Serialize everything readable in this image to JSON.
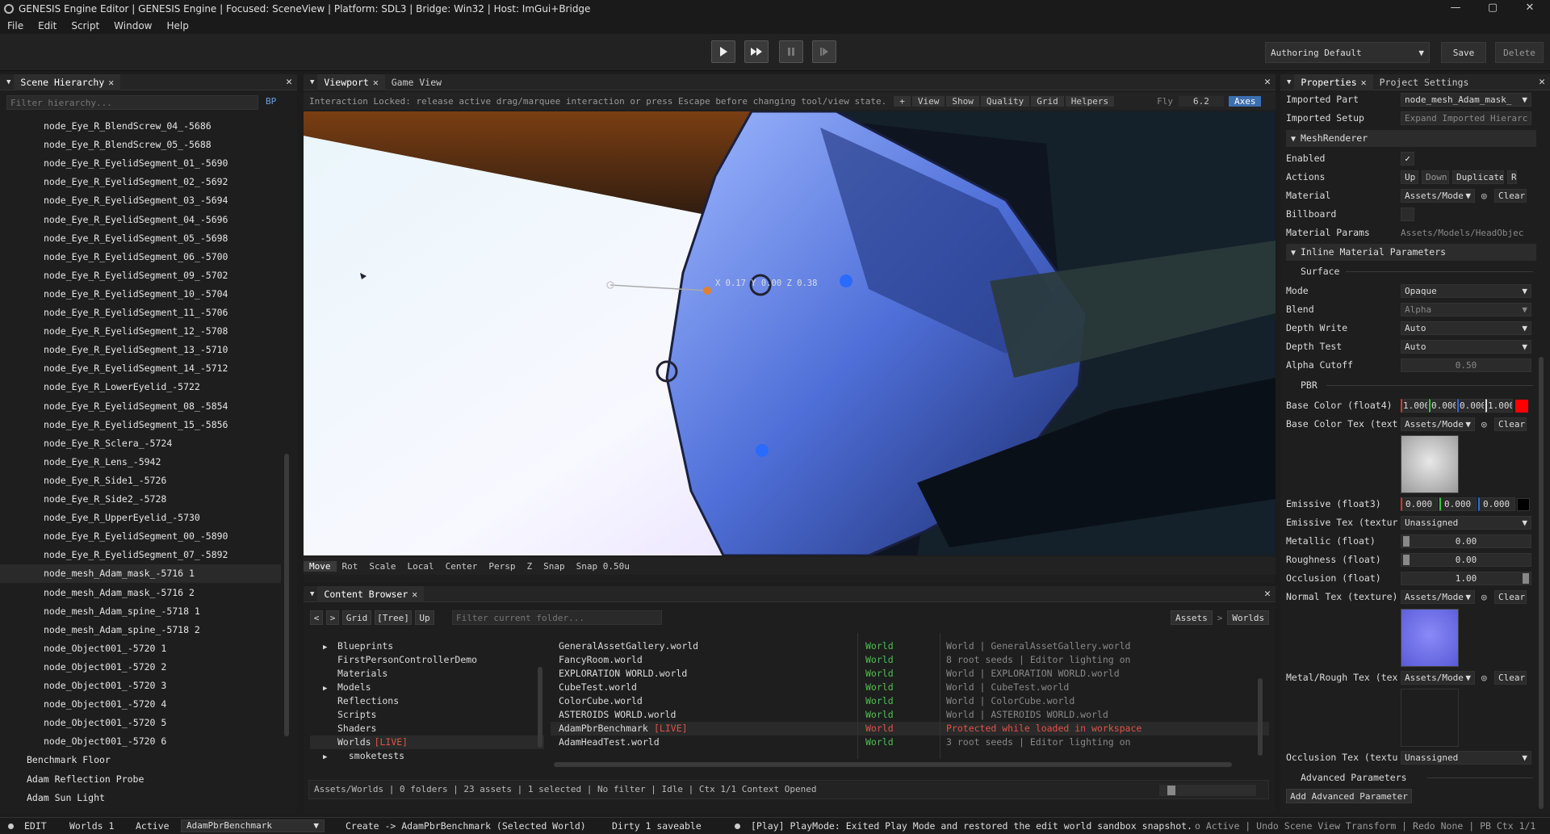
{
  "window": {
    "title": "GENESIS Engine Editor | GENESIS Engine | Focused: SceneView | Platform: SDL3 | Bridge: Win32 | Host: ImGui+Bridge",
    "min": "—",
    "max": "▢",
    "close": "✕"
  },
  "menu": [
    "File",
    "Edit",
    "Script",
    "Window",
    "Help"
  ],
  "toolbar": {
    "layout_combo": "Authoring Default",
    "save": "Save",
    "delete": "Delete"
  },
  "hierarchy": {
    "tab": "Scene Hierarchy",
    "filter_placeholder": "Filter hierarchy...",
    "bp": "BP",
    "items": [
      "node_Eye_R_BlendScrew_04_-5686",
      "node_Eye_R_BlendScrew_05_-5688",
      "node_Eye_R_EyelidSegment_01_-5690",
      "node_Eye_R_EyelidSegment_02_-5692",
      "node_Eye_R_EyelidSegment_03_-5694",
      "node_Eye_R_EyelidSegment_04_-5696",
      "node_Eye_R_EyelidSegment_05_-5698",
      "node_Eye_R_EyelidSegment_06_-5700",
      "node_Eye_R_EyelidSegment_09_-5702",
      "node_Eye_R_EyelidSegment_10_-5704",
      "node_Eye_R_EyelidSegment_11_-5706",
      "node_Eye_R_EyelidSegment_12_-5708",
      "node_Eye_R_EyelidSegment_13_-5710",
      "node_Eye_R_EyelidSegment_14_-5712",
      "node_Eye_R_LowerEyelid_-5722",
      "node_Eye_R_EyelidSegment_08_-5854",
      "node_Eye_R_EyelidSegment_15_-5856",
      "node_Eye_R_Sclera_-5724",
      "node_Eye_R_Lens_-5942",
      "node_Eye_R_Side1_-5726",
      "node_Eye_R_Side2_-5728",
      "node_Eye_R_UpperEyelid_-5730",
      "node_Eye_R_EyelidSegment_00_-5890",
      "node_Eye_R_EyelidSegment_07_-5892",
      "node_mesh_Adam_mask_-5716 1",
      "node_mesh_Adam_mask_-5716 2",
      "node_mesh_Adam_spine_-5718 1",
      "node_mesh_Adam_spine_-5718 2",
      "node_Object001_-5720 1",
      "node_Object001_-5720 2",
      "node_Object001_-5720 3",
      "node_Object001_-5720 4",
      "node_Object001_-5720 5",
      "node_Object001_-5720 6"
    ],
    "root_items": [
      "Benchmark Floor",
      "Adam Reflection Probe",
      "Adam Sun Light"
    ]
  },
  "viewport": {
    "tabs": [
      "Viewport",
      "Game View"
    ],
    "notice": "Interaction Locked: release active drag/marquee interaction or press Escape before changing tool/view state.",
    "top_buttons": [
      "+",
      "View",
      "Show",
      "Quality",
      "Grid",
      "Helpers"
    ],
    "fly_label": "Fly",
    "fly_value": "6.2",
    "axes": "Axes",
    "gizmo_readout": "X 0.17  Y 0.00  Z 0.38",
    "bottom_buttons": [
      "Move",
      "Rot",
      "Scale",
      "Local",
      "Center",
      "Persp",
      "Z",
      "Snap",
      "Snap 0.50u"
    ]
  },
  "content": {
    "tab": "Content Browser",
    "nav": [
      "<",
      ">",
      "Grid",
      "[Tree]",
      "Up"
    ],
    "filter_placeholder": "Filter current folder...",
    "crumbs": [
      "Assets",
      ">",
      "Worlds"
    ],
    "tree": [
      {
        "label": "Blueprints",
        "arrow": "▶"
      },
      {
        "label": "FirstPersonControllerDemo",
        "arrow": ""
      },
      {
        "label": "Materials",
        "arrow": ""
      },
      {
        "label": "Models",
        "arrow": "▶"
      },
      {
        "label": "Reflections",
        "arrow": ""
      },
      {
        "label": "Scripts",
        "arrow": ""
      },
      {
        "label": "Shaders",
        "arrow": ""
      },
      {
        "label": "Worlds",
        "arrow": "",
        "live": "[LIVE]"
      },
      {
        "label": "__smoketests",
        "arrow": "▶"
      }
    ],
    "rows": [
      {
        "name": "GeneralAssetGallery.world",
        "type": "World",
        "desc": "World | GeneralAssetGallery.world"
      },
      {
        "name": "FancyRoom.world",
        "type": "World",
        "desc": "8 root seeds | Editor lighting on"
      },
      {
        "name": "EXPLORATION WORLD.world",
        "type": "World",
        "desc": "World | EXPLORATION WORLD.world"
      },
      {
        "name": "CubeTest.world",
        "type": "World",
        "desc": "World | CubeTest.world"
      },
      {
        "name": "ColorCube.world",
        "type": "World",
        "desc": "World | ColorCube.world"
      },
      {
        "name": "ASTEROIDS WORLD.world",
        "type": "World",
        "desc": "World | ASTEROIDS WORLD.world"
      },
      {
        "name": "AdamPbrBenchmark",
        "live": "[LIVE]",
        "type": "World",
        "desc": "Protected while loaded in workspace"
      },
      {
        "name": "AdamHeadTest.world",
        "type": "World",
        "desc": "3 root seeds | Editor lighting on"
      }
    ],
    "status": "Assets/Worlds | 0 folders | 23 assets | 1 selected | No filter | Idle | Ctx 1/1 Context Opened"
  },
  "properties": {
    "tabs": [
      "Properties",
      "Project Settings"
    ],
    "imported_part_label": "Imported Part",
    "imported_part_value": "node_mesh_Adam_mask_",
    "imported_setup_label": "Imported Setup",
    "imported_setup_value": "Expand Imported Hierarc",
    "mesh_renderer": "MeshRenderer",
    "enabled_label": "Enabled",
    "actions_label": "Actions",
    "actions": [
      "Up",
      "Down",
      "Duplicate",
      "R"
    ],
    "material_label": "Material",
    "material_value": "Assets/Mode",
    "clear": "Clear",
    "billboard_label": "Billboard",
    "material_params_label": "Material Params",
    "material_params_value": "Assets/Models/HeadObjec",
    "inline_header": "Inline Material Parameters",
    "surface": "Surface",
    "mode_label": "Mode",
    "mode_value": "Opaque",
    "blend_label": "Blend",
    "blend_value": "Alpha",
    "depth_write_label": "Depth Write",
    "depth_write_value": "Auto",
    "depth_test_label": "Depth Test",
    "depth_test_value": "Auto",
    "alpha_cutoff_label": "Alpha Cutoff",
    "alpha_cutoff_value": "0.50",
    "pbr": "PBR",
    "base_color_label": "Base Color (float4)",
    "base_color": [
      "1.000",
      "0.000",
      "0.000",
      "1.000"
    ],
    "base_color_tex_label": "Base Color Tex (text",
    "base_color_tex_value": "Assets/Mode",
    "emissive_label": "Emissive (float3)",
    "emissive": [
      "0.000",
      "0.000",
      "0.000"
    ],
    "emissive_tex_label": "Emissive Tex (textur",
    "emissive_tex_value": "Unassigned",
    "metallic_label": "Metallic (float)",
    "metallic_value": "0.00",
    "roughness_label": "Roughness (float)",
    "roughness_value": "0.00",
    "occlusion_label": "Occlusion (float)",
    "occlusion_value": "1.00",
    "normal_tex_label": "Normal Tex (texture)",
    "normal_tex_value": "Assets/Mode",
    "metal_rough_label": "Metal/Rough Tex (tex",
    "metal_rough_value": "Assets/Mode",
    "occlusion_tex_label": "Occlusion Tex (textu",
    "occlusion_tex_value": "Unassigned",
    "advanced": "Advanced Parameters",
    "add_advanced": "Add Advanced Parameter"
  },
  "statusbar": {
    "mode": "EDIT",
    "worlds": "Worlds 1",
    "active": "Active",
    "active_world": "AdamPbrBenchmark",
    "create": "Create -> AdamPbrBenchmark (Selected World)",
    "dirty": "Dirty 1 saveable",
    "play": "[Play] PlayMode: Exited Play Mode and restored the edit world sandbox snapshot.",
    "right": "o Active | Undo Scene View Transform | Redo None | PB Ctx 1/1"
  },
  "colors": {
    "accent_red": "#e0302a",
    "live_red": "#e0524a",
    "world_green": "#4fc04f",
    "selection": "#2a2a2a"
  }
}
